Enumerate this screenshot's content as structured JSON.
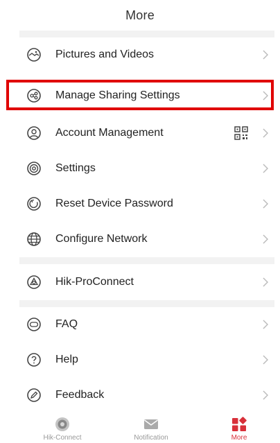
{
  "header": {
    "title": "More"
  },
  "menu": {
    "items": [
      {
        "label": "Pictures and Videos",
        "icon": "pictures-icon"
      },
      {
        "label": "Manage Sharing Settings",
        "icon": "share-icon"
      },
      {
        "label": "Account Management",
        "icon": "account-icon",
        "extra_icon": "qr-code-icon"
      },
      {
        "label": "Settings",
        "icon": "settings-icon"
      },
      {
        "label": "Reset Device Password",
        "icon": "reset-icon"
      },
      {
        "label": "Configure Network",
        "icon": "globe-icon"
      },
      {
        "label": "Hik-ProConnect",
        "icon": "proconnect-icon"
      },
      {
        "label": "FAQ",
        "icon": "faq-icon"
      },
      {
        "label": "Help",
        "icon": "help-icon"
      },
      {
        "label": "Feedback",
        "icon": "feedback-icon"
      }
    ],
    "highlighted_item": "Manage Sharing Settings",
    "highlight_color": "#e00000"
  },
  "tabbar": {
    "tabs": [
      {
        "label": "Hik-Connect",
        "icon": "hik-connect-icon",
        "active": false
      },
      {
        "label": "Notification",
        "icon": "envelope-icon",
        "active": false
      },
      {
        "label": "More",
        "icon": "more-grid-icon",
        "active": true
      }
    ],
    "active_color": "#d8303a"
  }
}
